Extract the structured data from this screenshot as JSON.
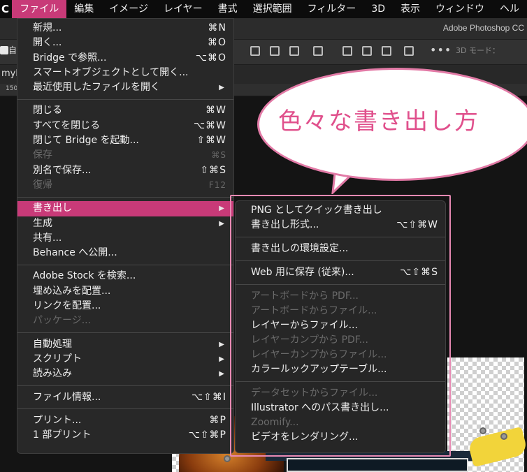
{
  "menubar": {
    "app_label": "C",
    "items": [
      "ファイル",
      "編集",
      "イメージ",
      "レイヤー",
      "書式",
      "選択範囲",
      "フィルター",
      "3D",
      "表示",
      "ウィンドウ",
      "ヘル"
    ]
  },
  "background": {
    "app_name": "Adobe Photoshop CC",
    "option_checkbox_label": "自",
    "mode_3d_label": "3D モード：",
    "tab_label": "myk",
    "ruler_label": "150"
  },
  "file_menu": {
    "items": [
      {
        "label": "新規...",
        "shortcut": "⌘N"
      },
      {
        "label": "開く...",
        "shortcut": "⌘O"
      },
      {
        "label": "Bridge で参照...",
        "shortcut": "⌥⌘O"
      },
      {
        "label": "スマートオブジェクトとして開く...",
        "shortcut": ""
      },
      {
        "label": "最近使用したファイルを開く",
        "shortcut": ""
      },
      {
        "label": "閉じる",
        "shortcut": "⌘W"
      },
      {
        "label": "すべてを閉じる",
        "shortcut": "⌥⌘W"
      },
      {
        "label": "閉じて Bridge を起動...",
        "shortcut": "⇧⌘W"
      },
      {
        "label": "保存",
        "shortcut": "⌘S"
      },
      {
        "label": "別名で保存...",
        "shortcut": "⇧⌘S"
      },
      {
        "label": "復帰",
        "shortcut": "F12"
      },
      {
        "label": "書き出し",
        "shortcut": ""
      },
      {
        "label": "生成",
        "shortcut": ""
      },
      {
        "label": "共有...",
        "shortcut": ""
      },
      {
        "label": "Behance へ公開...",
        "shortcut": ""
      },
      {
        "label": "Adobe Stock を検索...",
        "shortcut": ""
      },
      {
        "label": "埋め込みを配置...",
        "shortcut": ""
      },
      {
        "label": "リンクを配置...",
        "shortcut": ""
      },
      {
        "label": "パッケージ...",
        "shortcut": ""
      },
      {
        "label": "自動処理",
        "shortcut": ""
      },
      {
        "label": "スクリプト",
        "shortcut": ""
      },
      {
        "label": "読み込み",
        "shortcut": ""
      },
      {
        "label": "ファイル情報...",
        "shortcut": "⌥⇧⌘I"
      },
      {
        "label": "プリント...",
        "shortcut": "⌘P"
      },
      {
        "label": "1 部プリント",
        "shortcut": "⌥⇧⌘P"
      }
    ]
  },
  "export_submenu": {
    "items": [
      {
        "label": "PNG としてクイック書き出し",
        "shortcut": ""
      },
      {
        "label": "書き出し形式...",
        "shortcut": "⌥⇧⌘W"
      },
      {
        "label": "書き出しの環境設定...",
        "shortcut": ""
      },
      {
        "label": "Web 用に保存 (従来)...",
        "shortcut": "⌥⇧⌘S"
      },
      {
        "label": "アートボードから PDF...",
        "shortcut": ""
      },
      {
        "label": "アートボードからファイル...",
        "shortcut": ""
      },
      {
        "label": "レイヤーからファイル...",
        "shortcut": ""
      },
      {
        "label": "レイヤーカンプから PDF...",
        "shortcut": ""
      },
      {
        "label": "レイヤーカンプからファイル...",
        "shortcut": ""
      },
      {
        "label": "カラールックアップテーブル...",
        "shortcut": ""
      },
      {
        "label": "データセットからファイル...",
        "shortcut": ""
      },
      {
        "label": "Illustrator へのパス書き出し...",
        "shortcut": ""
      },
      {
        "label": "Zoomify...",
        "shortcut": ""
      },
      {
        "label": "ビデオをレンダリング...",
        "shortcut": ""
      }
    ]
  },
  "callout": {
    "text": "色々な書き出し方"
  },
  "colors": {
    "accent": "#c83a78",
    "callout_border": "#e27aa6",
    "callout_text": "#e0508c"
  }
}
